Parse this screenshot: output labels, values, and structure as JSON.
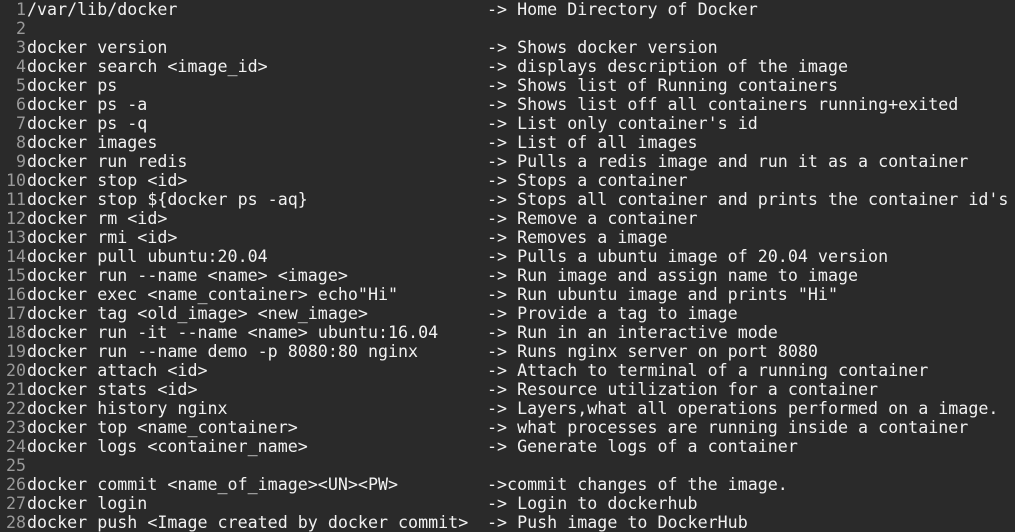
{
  "editor": {
    "lines": [
      {
        "num": "1",
        "cmd": "/var/lib/docker",
        "desc": "-> Home Directory of Docker"
      },
      {
        "num": "2",
        "cmd": "",
        "desc": ""
      },
      {
        "num": "3",
        "cmd": "docker version",
        "desc": "-> Shows docker version"
      },
      {
        "num": "4",
        "cmd": "docker search <image_id>",
        "desc": "-> displays description of the image"
      },
      {
        "num": "5",
        "cmd": "docker ps",
        "desc": "-> Shows list of Running containers"
      },
      {
        "num": "6",
        "cmd": "docker ps -a",
        "desc": "-> Shows list off all containers running+exited"
      },
      {
        "num": "7",
        "cmd": "docker ps -q",
        "desc": "-> List only container's id"
      },
      {
        "num": "8",
        "cmd": "docker images",
        "desc": "-> List of all images"
      },
      {
        "num": "9",
        "cmd": "docker run redis",
        "desc": "-> Pulls a redis image and run it as a container"
      },
      {
        "num": "10",
        "cmd": "docker stop <id>",
        "desc": "-> Stops a container"
      },
      {
        "num": "11",
        "cmd": "docker stop ${docker ps -aq}",
        "desc": "-> Stops all container and prints the container id's"
      },
      {
        "num": "12",
        "cmd": "docker rm <id>",
        "desc": "-> Remove a container"
      },
      {
        "num": "13",
        "cmd": "docker rmi <id>",
        "desc": "-> Removes a image"
      },
      {
        "num": "14",
        "cmd": "docker pull ubuntu:20.04",
        "desc": "-> Pulls a ubuntu image of 20.04 version"
      },
      {
        "num": "15",
        "cmd": "docker run --name <name> <image>",
        "desc": "-> Run image and assign name to image"
      },
      {
        "num": "16",
        "cmd": "docker exec <name_container> echo\"Hi\"",
        "desc": "-> Run ubuntu image and prints \"Hi\""
      },
      {
        "num": "17",
        "cmd": "docker tag <old_image> <new_image>",
        "desc": "-> Provide a tag to image"
      },
      {
        "num": "18",
        "cmd": "docker run -it --name <name> ubuntu:16.04",
        "desc": "-> Run in an interactive mode"
      },
      {
        "num": "19",
        "cmd": "docker run --name demo -p 8080:80 nginx",
        "desc": "-> Runs nginx server on port 8080"
      },
      {
        "num": "20",
        "cmd": "docker attach <id>",
        "desc": "-> Attach to terminal of a running container"
      },
      {
        "num": "21",
        "cmd": "docker stats <id>",
        "desc": "-> Resource utilization for a container"
      },
      {
        "num": "22",
        "cmd": "docker history nginx",
        "desc": "-> Layers,what all operations performed on a image."
      },
      {
        "num": "23",
        "cmd": "docker top <name_container>",
        "desc": "-> what processes are running inside a container"
      },
      {
        "num": "24",
        "cmd": "docker logs <container_name>",
        "desc": "-> Generate logs of a container"
      },
      {
        "num": "25",
        "cmd": "",
        "desc": ""
      },
      {
        "num": "26",
        "cmd": "docker commit <name_of_image><UN><PW>",
        "desc": "->commit changes of the image."
      },
      {
        "num": "27",
        "cmd": "docker login",
        "desc": "-> Login to dockerhub"
      },
      {
        "num": "28",
        "cmd": "docker push <Image created by docker commit>",
        "desc": "-> Push image to DockerHub"
      }
    ]
  },
  "colors": {
    "background": "#2a2a2a",
    "text": "#f2f2f2",
    "line_numbers": "#9a9a9a"
  }
}
